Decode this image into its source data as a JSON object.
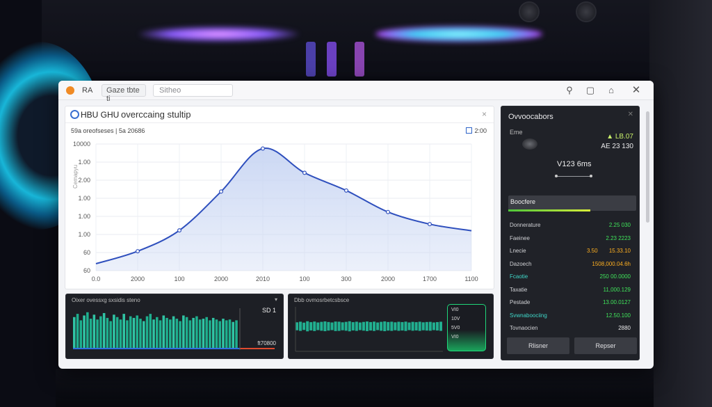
{
  "titlebar": {
    "app_short": "RA",
    "tab_label": "Gaze  tbte  ti",
    "search_placeholder": "Sitheo"
  },
  "main": {
    "brand": "HBU GHU",
    "title": "overccaing stultip",
    "subtitle_left": "59a oreofseses | 5a 20686",
    "subtitle_right": "2:00",
    "y_axis_label": "Cemapyu",
    "close": "×"
  },
  "chart_data": {
    "type": "area",
    "x": [
      0,
      1,
      2,
      3,
      4,
      5,
      6,
      7,
      8
    ],
    "x_tick_labels": [
      "0.0",
      "2000",
      "100",
      "2000",
      "2010",
      "100",
      "300",
      "2000",
      "1700",
      "1100"
    ],
    "y_tick_labels": [
      "10000",
      "1.00",
      "2.00",
      "1.00",
      "1.00",
      "1.00",
      "60",
      "60"
    ],
    "values": [
      0.2,
      0.56,
      1.16,
      2.28,
      3.52,
      2.82,
      2.31,
      1.69,
      1.34,
      1.15
    ],
    "ylim": [
      0,
      3.65
    ],
    "grid": true,
    "color": "#2e4fbd",
    "fill": "#c9d6f3"
  },
  "panel_one": {
    "header": "Oixer ovessxg sxsidis steno",
    "value": "SD 1",
    "footer": "ft70800",
    "bars": [
      0.78,
      0.86,
      0.7,
      0.82,
      0.9,
      0.74,
      0.84,
      0.72,
      0.8,
      0.88,
      0.76,
      0.68,
      0.84,
      0.78,
      0.72,
      0.86,
      0.7,
      0.8,
      0.76,
      0.82,
      0.74,
      0.68,
      0.8,
      0.86,
      0.72,
      0.78,
      0.7,
      0.82,
      0.76,
      0.72,
      0.8,
      0.74,
      0.68,
      0.82,
      0.78,
      0.7,
      0.76,
      0.8,
      0.72,
      0.74,
      0.78,
      0.7,
      0.76,
      0.72,
      0.68,
      0.74,
      0.7,
      0.72,
      0.66,
      0.7
    ]
  },
  "panel_two": {
    "header": "Dbb ovmosrbetcsbsce",
    "legend": [
      "VI0",
      "10V",
      "5V0",
      "VI0"
    ],
    "wave": [
      0.52,
      0.6,
      0.48,
      0.66,
      0.54,
      0.62,
      0.5,
      0.58,
      0.64,
      0.56,
      0.5,
      0.62,
      0.6,
      0.52,
      0.58,
      0.66,
      0.54,
      0.6,
      0.5,
      0.57,
      0.63,
      0.55,
      0.61,
      0.5,
      0.58,
      0.64,
      0.56,
      0.6,
      0.52,
      0.59,
      0.55,
      0.61,
      0.5,
      0.58,
      0.54,
      0.6,
      0.52,
      0.56,
      0.58,
      0.5,
      0.55,
      0.6
    ]
  },
  "side": {
    "title": "Ovvoocabors",
    "subtitle": "Eme",
    "up": "▲ LB.07",
    "delta": "AE 23 130",
    "version": "V123 6ms",
    "bar_label": "Boocfere",
    "bar_progress": 0.64,
    "stats": [
      {
        "key": "Donnerature",
        "mid": "",
        "value": "2.25 030",
        "color": "#3fe35a"
      },
      {
        "key": "Faeinee",
        "mid": "",
        "value": "2.23 2223",
        "color": "#3fe35a"
      },
      {
        "key": "Lnecie",
        "mid": "3.50",
        "value": "15.33.10",
        "color": "#ffb020"
      },
      {
        "key": "Dazoech",
        "mid": "",
        "value": "1508,000.04.6h",
        "color": "#ffb020"
      },
      {
        "key": "Fcaotie",
        "mid": "",
        "value": "250 00.0000",
        "color": "#3fe35a"
      },
      {
        "key": "Taxatie",
        "mid": "",
        "value": "11,000.129",
        "color": "#3fe35a"
      },
      {
        "key": "Pestade",
        "mid": "",
        "value": "13.00.0127",
        "color": "#3fe35a"
      },
      {
        "key": "Svwnaboociing",
        "mid": "",
        "value": "12.50.100",
        "color": "#3fe35a"
      },
      {
        "key": "Tovnaocien",
        "mid": "",
        "value": "2880",
        "color": "#e9e9ea"
      }
    ],
    "stat_key_colors": [
      "#cfd0d4",
      "#cfd0d4",
      "#cfd0d4",
      "#cfd0d4",
      "#3fd7c8",
      "#cfd0d4",
      "#cfd0d4",
      "#3fd7c8",
      "#cfd0d4"
    ],
    "button_left": "Rlisner",
    "button_right": "Repser"
  }
}
